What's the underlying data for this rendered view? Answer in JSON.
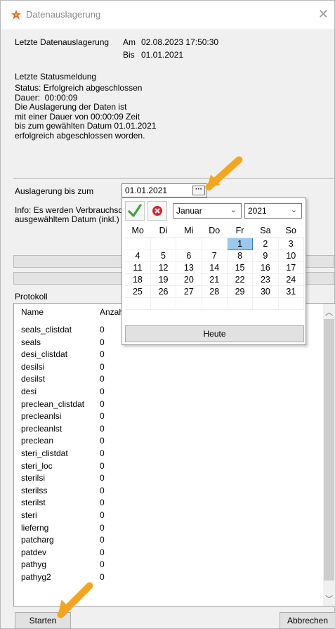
{
  "window": {
    "title": "Datenauslagerung",
    "close": "✕"
  },
  "last_export": {
    "label": "Letzte Datenauslagerung",
    "am_label": "Am",
    "am_value": "02.08.2023 17:50:30",
    "bis_label": "Bis",
    "bis_value": "01.01.2021"
  },
  "status": {
    "heading": "Letzte Statusmeldung",
    "text": "Status: Erfolgreich abgeschlossen\nDauer:  00:00:09\nDie Auslagerung der Daten ist\nmit einer Dauer von 00:00:09 Zeit\nbis zum gewählten Datum 01.01.2021\nerfolgreich abgeschlossen worden."
  },
  "export_until": {
    "label": "Auslagerung bis zum",
    "value": "01.01.2021",
    "button": "···"
  },
  "info": {
    "line1": "Info: Es werden Verbrauchsd",
    "line2": "ausgewähltem Datum (inkl.) a"
  },
  "calendar": {
    "month": "Januar",
    "year": "2021",
    "weekdays": [
      "Mo",
      "Di",
      "Mi",
      "Do",
      "Fr",
      "Sa",
      "So"
    ],
    "weeks": [
      [
        "",
        "",
        "",
        "",
        "1",
        "2",
        "3"
      ],
      [
        "4",
        "5",
        "6",
        "7",
        "8",
        "9",
        "10"
      ],
      [
        "11",
        "12",
        "13",
        "14",
        "15",
        "16",
        "17"
      ],
      [
        "18",
        "19",
        "20",
        "21",
        "22",
        "23",
        "24"
      ],
      [
        "25",
        "26",
        "27",
        "28",
        "29",
        "30",
        "31"
      ],
      [
        "",
        "",
        "",
        "",
        "",
        "",
        ""
      ]
    ],
    "selected_day": "1",
    "today_button": "Heute",
    "confirm_icon": "check-icon",
    "cancel_icon": "cancel-icon"
  },
  "protocol": {
    "label": "Protokoll",
    "col_name": "Name",
    "col_count": "Anzah",
    "rows": [
      [
        "seals_clistdat",
        "0"
      ],
      [
        "seals",
        "0"
      ],
      [
        "desi_clistdat",
        "0"
      ],
      [
        "desilsi",
        "0"
      ],
      [
        "desilst",
        "0"
      ],
      [
        "desi",
        "0"
      ],
      [
        "preclean_clistdat",
        "0"
      ],
      [
        "precleanlsi",
        "0"
      ],
      [
        "precleanlst",
        "0"
      ],
      [
        "preclean",
        "0"
      ],
      [
        "steri_clistdat",
        "0"
      ],
      [
        "steri_loc",
        "0"
      ],
      [
        "sterilsi",
        "0"
      ],
      [
        "sterilss",
        "0"
      ],
      [
        "sterilst",
        "0"
      ],
      [
        "steri",
        "0"
      ],
      [
        "lieferng",
        "0"
      ],
      [
        "patcharg",
        "0"
      ],
      [
        "patdev",
        "0"
      ],
      [
        "pathyg",
        "0"
      ],
      [
        "pathyg2",
        "0"
      ]
    ]
  },
  "buttons": {
    "start": "Starten",
    "cancel": "Abbrechen"
  },
  "colors": {
    "highlight_arrow": "#f4a520",
    "selected_day": "#99c9ef",
    "check": "#3aa63a",
    "cancel": "#d9232d"
  }
}
